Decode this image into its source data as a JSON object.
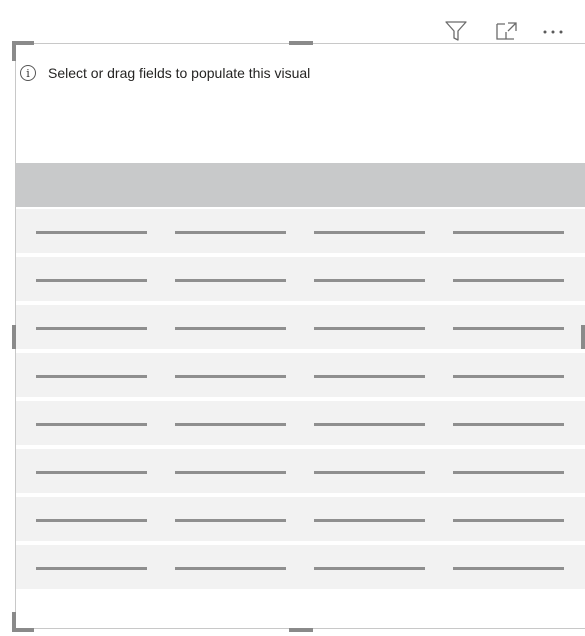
{
  "toolbar": {
    "filter_icon": "filter-icon",
    "focus_icon": "focus-mode-icon",
    "more_icon": "more-options-icon"
  },
  "visual": {
    "info_icon": "info-icon",
    "info_glyph": "i",
    "placeholder_message": "Select or drag fields to populate this visual",
    "placeholder_rows": 8,
    "placeholder_columns": 4
  },
  "colors": {
    "border": "#c8c8c8",
    "header_band": "#c8c9ca",
    "row_fill": "#f2f2f2",
    "dash": "#8f8f8f",
    "text": "#252423"
  }
}
